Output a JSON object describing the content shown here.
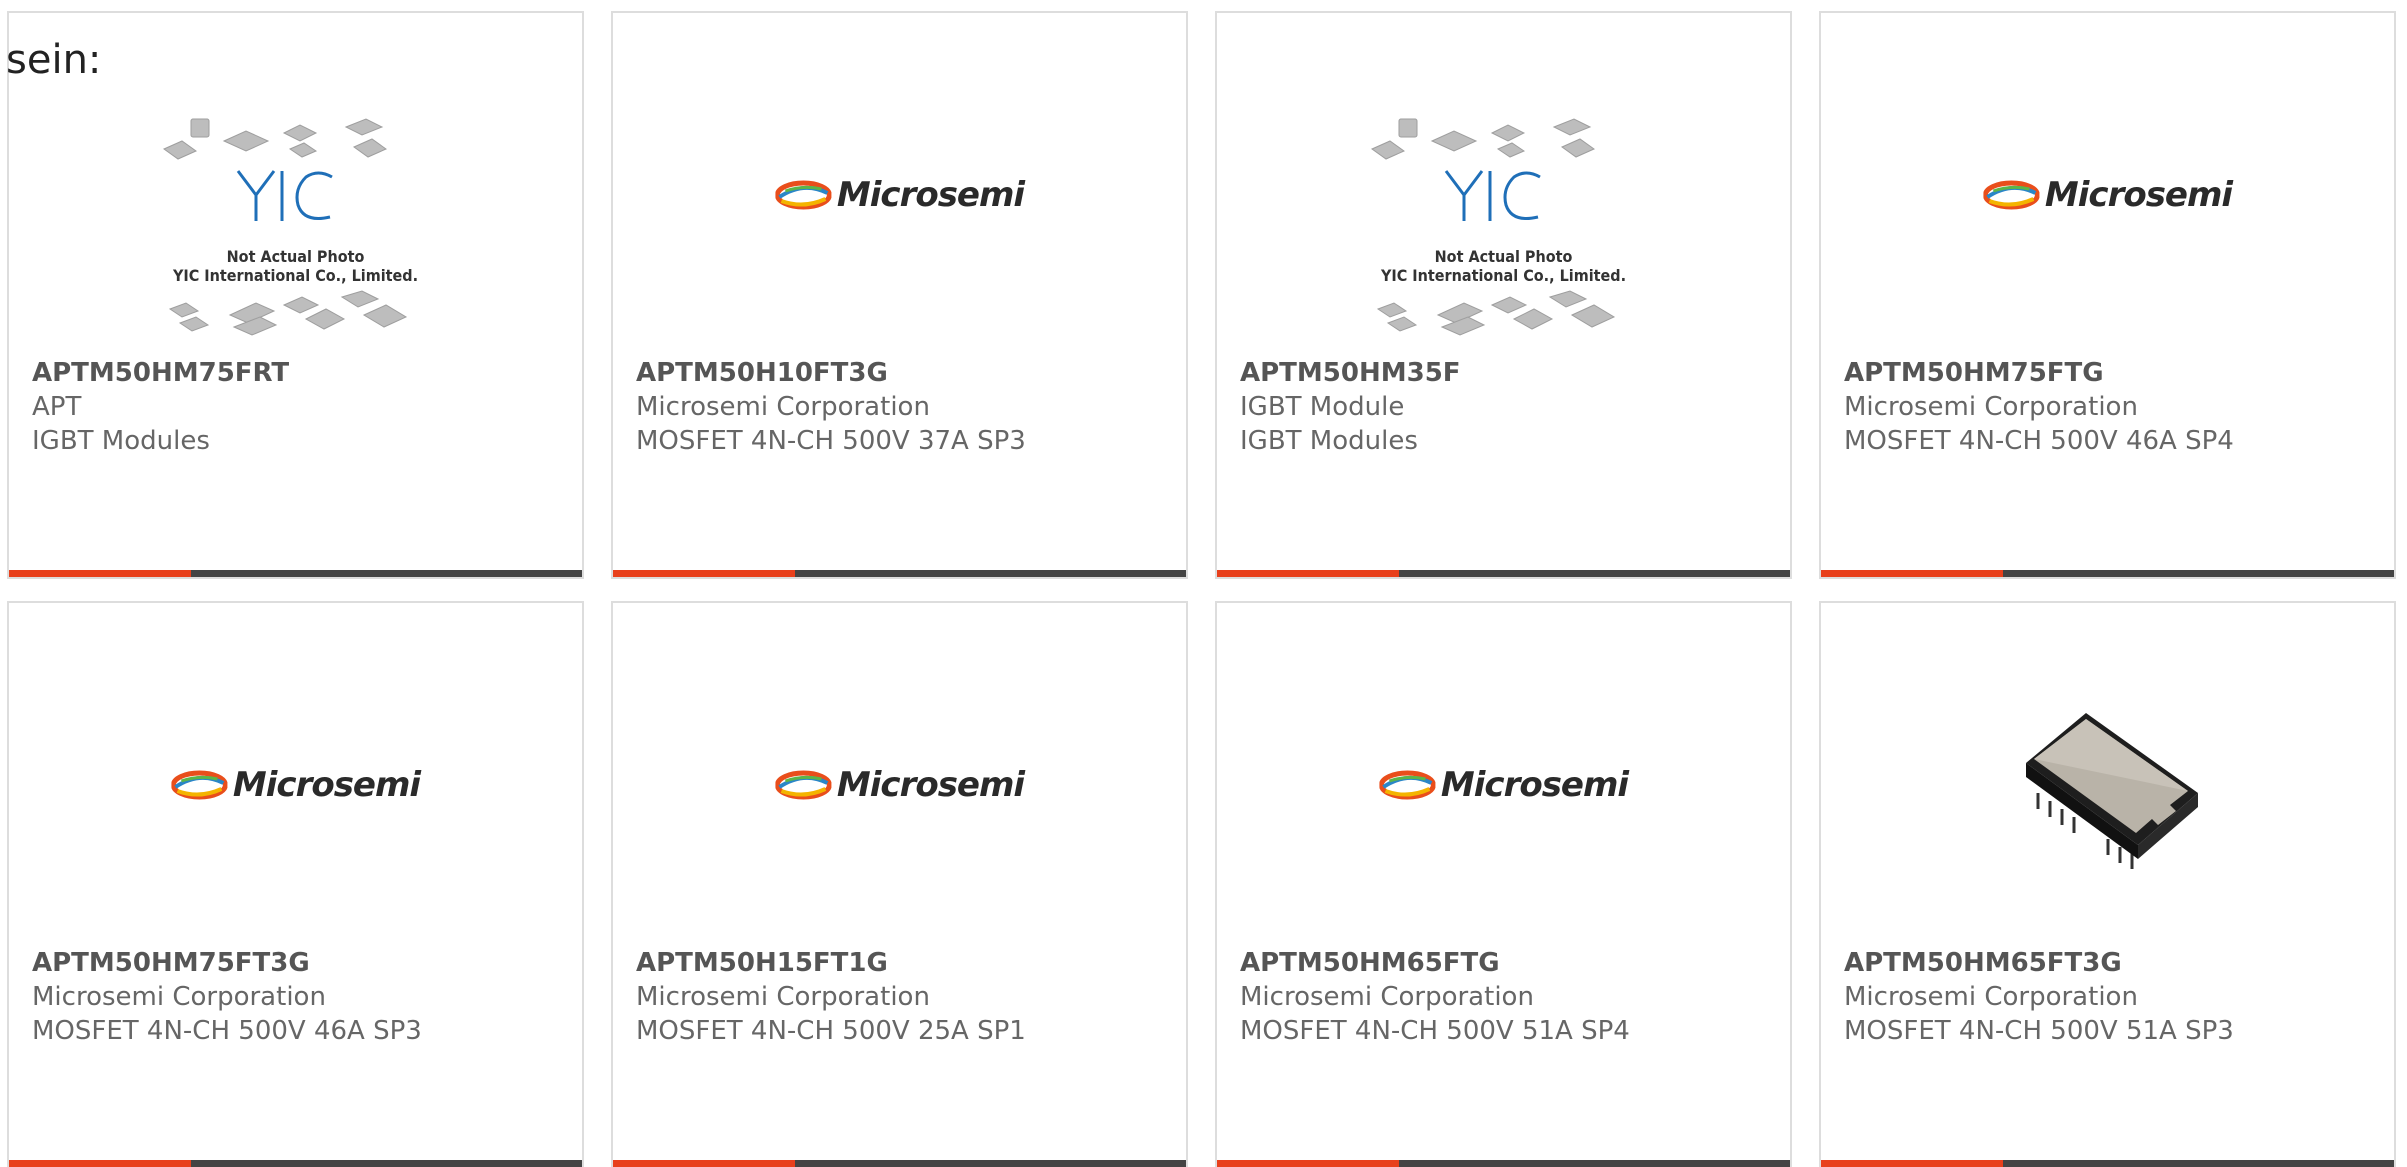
{
  "heading": "sein:",
  "placeholder": {
    "line1": "Not Actual Photo",
    "line2": "YIC International Co., Limited.",
    "logo": "YIC"
  },
  "brand_logo": "Microsemi",
  "colors": {
    "accent": "#e8401c",
    "bar": "#444444",
    "border": "#dddddd",
    "text": "#666666"
  },
  "cards": [
    {
      "part": "APTM50HM75FRT",
      "maker": "APT",
      "desc": "IGBT Modules",
      "image": "yic-placeholder"
    },
    {
      "part": "APTM50H10FT3G",
      "maker": "Microsemi Corporation",
      "desc": "MOSFET 4N-CH 500V 37A SP3",
      "image": "microsemi-logo"
    },
    {
      "part": "APTM50HM35F",
      "maker": "IGBT Module",
      "desc": "IGBT Modules",
      "image": "yic-placeholder"
    },
    {
      "part": "APTM50HM75FTG",
      "maker": "Microsemi Corporation",
      "desc": "MOSFET 4N-CH 500V 46A SP4",
      "image": "microsemi-logo"
    },
    {
      "part": "APTM50HM75FT3G",
      "maker": "Microsemi Corporation",
      "desc": "MOSFET 4N-CH 500V 46A SP3",
      "image": "microsemi-logo"
    },
    {
      "part": "APTM50H15FT1G",
      "maker": "Microsemi Corporation",
      "desc": "MOSFET 4N-CH 500V 25A SP1",
      "image": "microsemi-logo"
    },
    {
      "part": "APTM50HM65FTG",
      "maker": "Microsemi Corporation",
      "desc": "MOSFET 4N-CH 500V 51A SP4",
      "image": "microsemi-logo"
    },
    {
      "part": "APTM50HM65FT3G",
      "maker": "Microsemi Corporation",
      "desc": "MOSFET 4N-CH 500V 51A SP3",
      "image": "module-photo"
    }
  ]
}
